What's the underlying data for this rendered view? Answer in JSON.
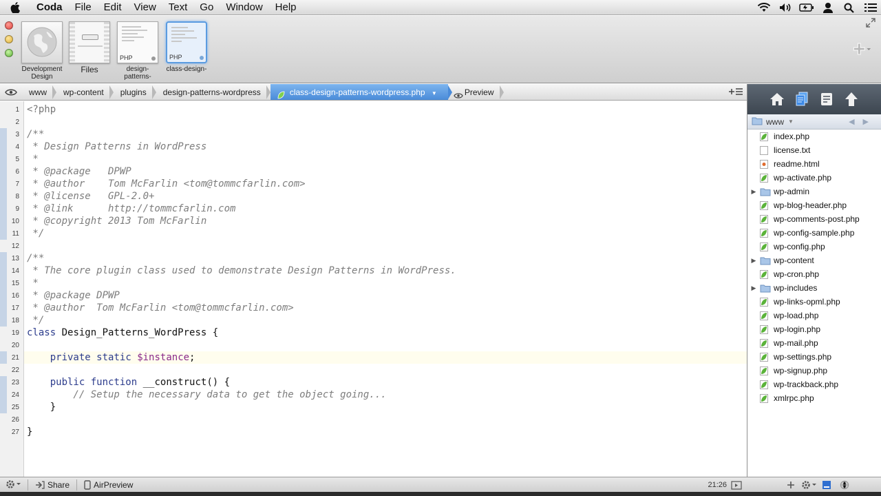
{
  "menubar": {
    "app": "Coda",
    "items": [
      "File",
      "Edit",
      "View",
      "Text",
      "Go",
      "Window",
      "Help"
    ]
  },
  "toolbar": {
    "sites": [
      {
        "label": "Development Design",
        "kind": "globe"
      },
      {
        "label": "Files",
        "kind": "files"
      },
      {
        "label": "design-patterns-",
        "tag": "PHP",
        "kind": "php"
      },
      {
        "label": "class-design-",
        "tag": "PHP",
        "kind": "php",
        "active": true
      }
    ]
  },
  "pathbar": {
    "crumbs": [
      "www",
      "wp-content",
      "plugins",
      "design-patterns-wordpress"
    ],
    "active_file": "class-design-patterns-wordpress.php",
    "preview_label": "Preview"
  },
  "editor": {
    "current_line": 21,
    "lines": [
      "<?php",
      "",
      "/**",
      " * Design Patterns in WordPress",
      " *",
      " * @package   DPWP",
      " * @author    Tom McFarlin <tom@tommcfarlin.com>",
      " * @license   GPL-2.0+",
      " * @link      http://tommcfarlin.com",
      " * @copyright 2013 Tom McFarlin",
      " */",
      "",
      "/**",
      " * The core plugin class used to demonstrate Design Patterns in WordPress.",
      " *",
      " * @package DPWP",
      " * @author  Tom McFarlin <tom@tommcfarlin.com>",
      " */",
      "class Design_Patterns_WordPress {",
      "",
      "    private static $instance;",
      "",
      "    public function __construct() {",
      "        // Setup the necessary data to get the object going...",
      "    }",
      "",
      "}"
    ]
  },
  "sidebar": {
    "root": "www",
    "files": [
      {
        "name": "index.php",
        "type": "php"
      },
      {
        "name": "license.txt",
        "type": "txt"
      },
      {
        "name": "readme.html",
        "type": "html"
      },
      {
        "name": "wp-activate.php",
        "type": "php"
      },
      {
        "name": "wp-admin",
        "type": "folder"
      },
      {
        "name": "wp-blog-header.php",
        "type": "php"
      },
      {
        "name": "wp-comments-post.php",
        "type": "php"
      },
      {
        "name": "wp-config-sample.php",
        "type": "php"
      },
      {
        "name": "wp-config.php",
        "type": "php"
      },
      {
        "name": "wp-content",
        "type": "folder"
      },
      {
        "name": "wp-cron.php",
        "type": "php"
      },
      {
        "name": "wp-includes",
        "type": "folder"
      },
      {
        "name": "wp-links-opml.php",
        "type": "php"
      },
      {
        "name": "wp-load.php",
        "type": "php"
      },
      {
        "name": "wp-login.php",
        "type": "php"
      },
      {
        "name": "wp-mail.php",
        "type": "php"
      },
      {
        "name": "wp-settings.php",
        "type": "php"
      },
      {
        "name": "wp-signup.php",
        "type": "php"
      },
      {
        "name": "wp-trackback.php",
        "type": "php"
      },
      {
        "name": "xmlrpc.php",
        "type": "php"
      }
    ]
  },
  "statusbar": {
    "share_label": "Share",
    "airpreview_label": "AirPreview",
    "cursor_position": "21:26"
  },
  "colors": {
    "accent": "#4a8bd9",
    "sidebar_toolbar": "#4a535e",
    "php_leaf": "#5bb33a"
  }
}
